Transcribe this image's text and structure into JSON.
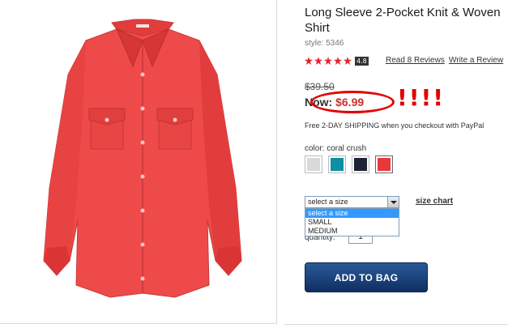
{
  "product": {
    "title": "Long Sleeve 2-Pocket Knit & Woven Shirt",
    "style_label": "style:",
    "style_number": "5346",
    "rating_value": "4.8",
    "read_reviews": "Read 8 Reviews",
    "write_review": "Write a Review"
  },
  "pricing": {
    "was": "$39.50",
    "now_label": "Now:",
    "now": "$6.99",
    "annotation": "!!!!"
  },
  "shipping": {
    "text": "Free 2-DAY SHIPPING when you checkout with PayPal"
  },
  "color": {
    "label": "color: coral crush",
    "swatches": [
      {
        "name": "light gray",
        "hex": "#d9d9d9"
      },
      {
        "name": "teal",
        "hex": "#0f8fa3"
      },
      {
        "name": "navy",
        "hex": "#1d2433"
      },
      {
        "name": "coral crush",
        "hex": "#e8393a"
      }
    ]
  },
  "size": {
    "selected": "select a size",
    "options": [
      "select a size",
      "SMALL",
      "MEDIUM"
    ],
    "chart_link": "size chart"
  },
  "quantity": {
    "label": "quantity:",
    "value": "1"
  },
  "cart": {
    "add_label": "ADD TO BAG"
  },
  "colors": {
    "shirt": "#ef4a4a",
    "star": "#e4262b",
    "annotation_red": "#e10000",
    "button_navy": "#1c447d"
  }
}
